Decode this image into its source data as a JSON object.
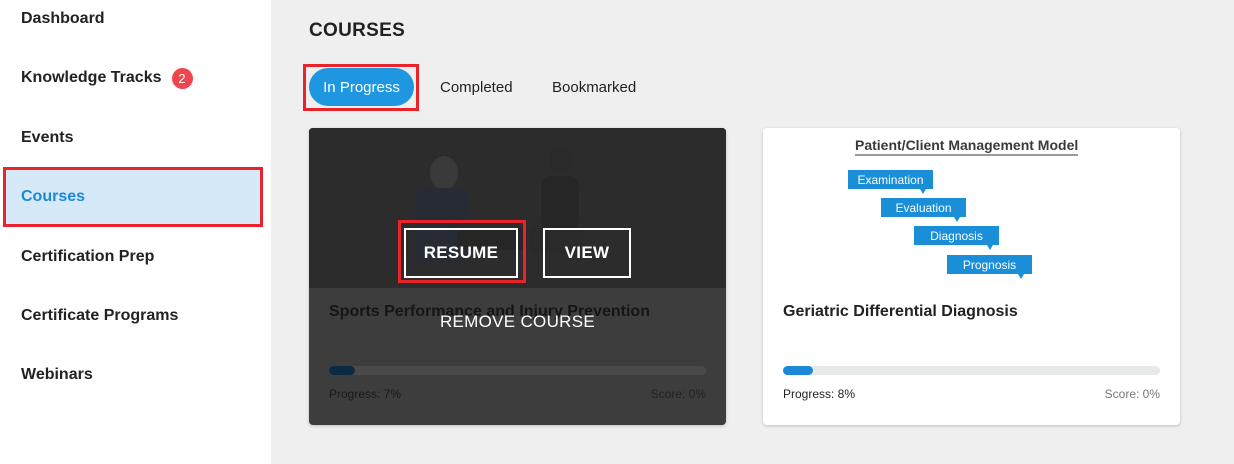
{
  "sidebar": {
    "items": [
      {
        "label": "Dashboard"
      },
      {
        "label": "Knowledge Tracks",
        "badge": "2"
      },
      {
        "label": "Events"
      },
      {
        "label": "Courses"
      },
      {
        "label": "Certification Prep"
      },
      {
        "label": "Certificate Programs"
      },
      {
        "label": "Webinars"
      }
    ]
  },
  "main": {
    "title": "COURSES",
    "tabs": [
      {
        "label": "In Progress"
      },
      {
        "label": "Completed"
      },
      {
        "label": "Bookmarked"
      }
    ]
  },
  "cards": [
    {
      "title": "Sports Performance and Injury Prevention",
      "progress_label": "Progress: 7%",
      "progress_value": 0.07,
      "score_label": "Score: 0%",
      "overlay": {
        "resume": "RESUME",
        "view": "VIEW",
        "remove": "REMOVE COURSE"
      }
    },
    {
      "title": "Geriatric Differential Diagnosis",
      "progress_label": "Progress: 8%",
      "progress_value": 0.08,
      "score_label": "Score: 0%",
      "diagram": {
        "title": "Patient/Client Management Model",
        "steps": [
          "Examination",
          "Evaluation",
          "Diagnosis",
          "Prognosis"
        ]
      }
    }
  ],
  "colors": {
    "accent": "#1e96e0",
    "highlight": "#e8232a",
    "badge": "#f0454d",
    "active_nav_bg": "#d6e9f8"
  }
}
